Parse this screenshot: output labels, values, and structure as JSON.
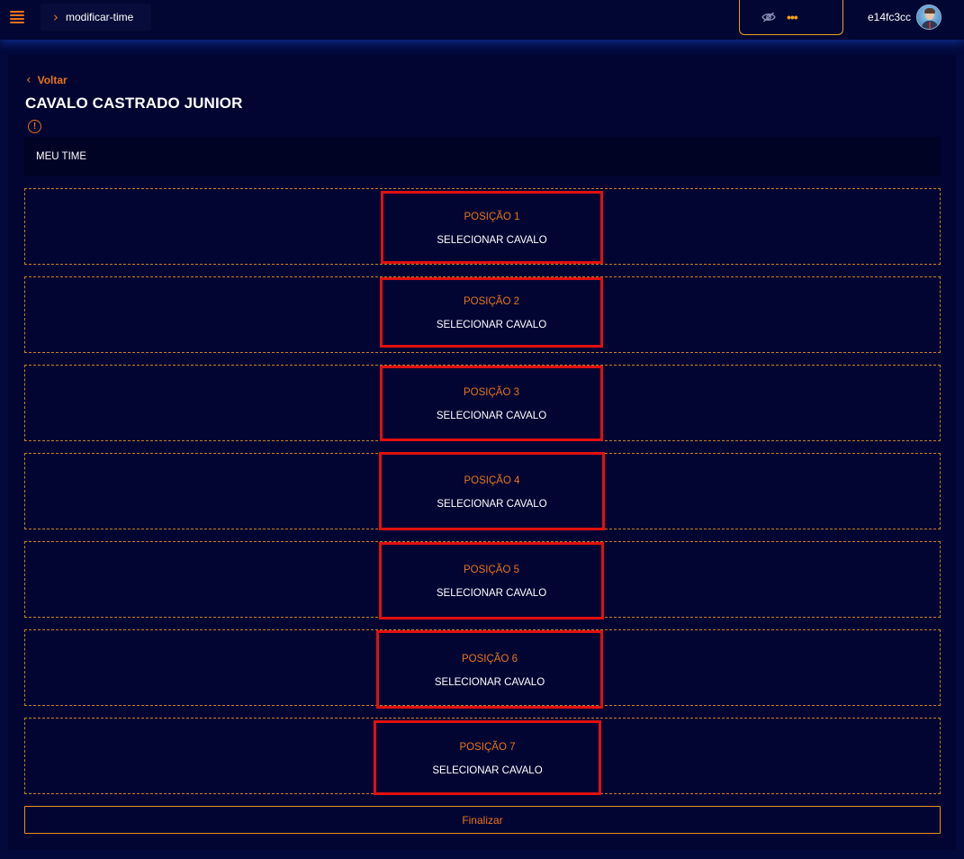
{
  "header": {
    "breadcrumb": "modificar-time",
    "balance_hidden": "•••",
    "username": "e14fc3cc"
  },
  "page": {
    "back_label": "Voltar",
    "title": "CAVALO CASTRADO JUNIOR",
    "section_label": "MEU TIME",
    "finalize_label": "Finalizar"
  },
  "slots": [
    {
      "position": "POSIÇÃO 1",
      "action": "SELECIONAR CAVALO"
    },
    {
      "position": "POSIÇÃO 2",
      "action": "SELECIONAR CAVALO"
    },
    {
      "position": "POSIÇÃO 3",
      "action": "SELECIONAR CAVALO"
    },
    {
      "position": "POSIÇÃO 4",
      "action": "SELECIONAR CAVALO"
    },
    {
      "position": "POSIÇÃO 5",
      "action": "SELECIONAR CAVALO"
    },
    {
      "position": "POSIÇÃO 6",
      "action": "SELECIONAR CAVALO"
    },
    {
      "position": "POSIÇÃO 7",
      "action": "SELECIONAR CAVALO"
    }
  ],
  "icons": {
    "menu": "hamburger-menu-icon",
    "breadcrumb": "chevron-right-icon",
    "balance_toggle": "eye-slash-icon",
    "back": "chevron-left-icon",
    "warning": "exclamation-circle-icon"
  },
  "colors": {
    "background": "#03093a",
    "accent": "#e8731e",
    "highlight_border": "#e01010",
    "dashed_border": "#c8801c"
  }
}
